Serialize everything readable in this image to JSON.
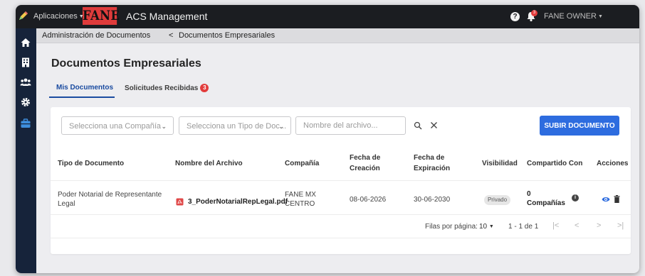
{
  "topbar": {
    "apps_menu": "Aplicaciones",
    "logo": "FANE",
    "title": "ACS Management",
    "help": "?",
    "notification_count": "3",
    "user": "FANE OWNER"
  },
  "breadcrumb": {
    "parent": "Administración de Documentos",
    "separator": "<",
    "current": "Documentos Empresariales"
  },
  "page_title": "Documentos Empresariales",
  "tabs": [
    {
      "label": "Mis Documentos",
      "active": true
    },
    {
      "label": "Solicitudes Recibidas",
      "badge": "3"
    }
  ],
  "filters": {
    "company_placeholder": "Selecciona una Compañía",
    "doc_type_placeholder": "Selecciona un Tipo de Doc...",
    "filename_placeholder": "Nombre del archivo...",
    "upload_label": "SUBIR DOCUMENTO"
  },
  "table": {
    "headers": {
      "tipo": "Tipo de Documento",
      "nombre": "Nombre del Archivo",
      "compania": "Compañía",
      "creacion_1": "Fecha de",
      "creacion_2": "Creación",
      "expiracion_1": "Fecha de",
      "expiracion_2": "Expiración",
      "visibilidad": "Visibilidad",
      "compartido": "Compartido Con",
      "acciones": "Acciones"
    },
    "rows": [
      {
        "tipo_1": "Poder Notarial de Representante",
        "tipo_2": "Legal",
        "archivo": "3_PoderNotarialRepLegal.pdf",
        "compania_1": "FANE MX",
        "compania_2": "CENTRO",
        "creacion": "08-06-2026",
        "expiracion": "30-06-2030",
        "visibilidad": "Privado",
        "compartido_count": "0",
        "compartido_label": "Compañías"
      }
    ]
  },
  "pagination": {
    "per_page_label": "Filas por página:",
    "per_page": "10",
    "range": "1 - 1 de 1",
    "first": "|<",
    "prev": "<",
    "next": ">",
    "last": ">|"
  },
  "colors": {
    "topbar": "#1b1d21",
    "sidebar": "#16233a",
    "accent": "#2d6cdf",
    "tab_active": "#1a4ba0",
    "badge": "#e23c3c"
  }
}
